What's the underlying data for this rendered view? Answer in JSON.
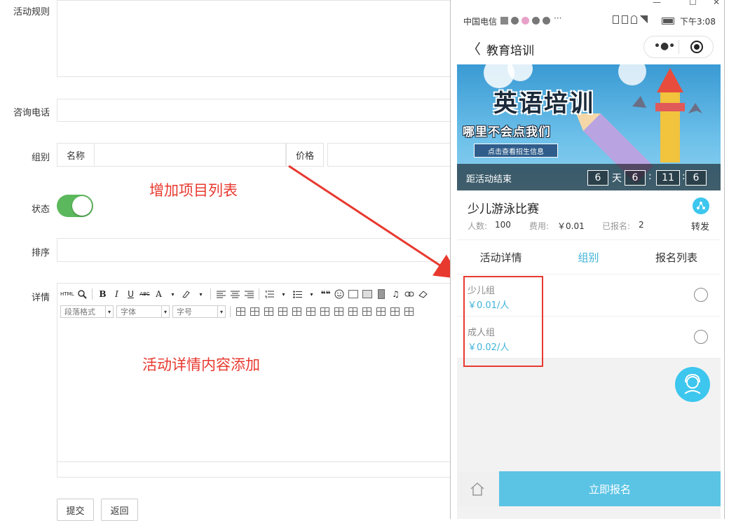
{
  "form": {
    "rules_label": "活动规则",
    "phone_label": "咨询电话",
    "group_label": "组别",
    "group_name_header": "名称",
    "group_price_header": "价格",
    "status_label": "状态",
    "sort_label": "排序",
    "detail_label": "详情",
    "status_on": true,
    "submit_label": "提交",
    "back_label": "返回"
  },
  "editor": {
    "html_label": "HTML",
    "bold": "B",
    "italic": "I",
    "underline": "U",
    "strike": "ABC",
    "fontcolor": "A",
    "quote": "❝❝",
    "paragraph_select": "段落格式",
    "font_select": "字体",
    "size_select": "字号"
  },
  "annotations": {
    "add_group": "增加项目列表",
    "add_detail": "活动详情内容添加"
  },
  "window": {
    "minimize": "—",
    "maximize": "☐",
    "close": "✕"
  },
  "phone": {
    "status": {
      "carrier": "中国电信",
      "time": "下午3:08"
    },
    "nav": {
      "back": "〈",
      "title": "教育培训"
    },
    "banner": {
      "title": "英语培训",
      "subtitle": "哪里不会点我们",
      "tag": "点击查看招生信息",
      "countdown_label": "距活动结束",
      "days": "6",
      "day_unit": "天",
      "hours": "6",
      "minutes": "11",
      "seconds": "6",
      "sep": ":"
    },
    "event": {
      "title": "少儿游泳比赛",
      "people_label": "人数:",
      "people_value": "100",
      "fee_label": "费用:",
      "fee_value": "￥0.01",
      "enrolled_label": "已报名:",
      "enrolled_value": "2",
      "share_label": "转发"
    },
    "tabs": [
      {
        "label": "活动详情",
        "active": false
      },
      {
        "label": "组别",
        "active": true
      },
      {
        "label": "报名列表",
        "active": false
      }
    ],
    "groups": [
      {
        "name": "少儿组",
        "price": "￥0.01/人"
      },
      {
        "name": "成人组",
        "price": "￥0.02/人"
      }
    ],
    "signup_label": "立即报名"
  },
  "colors": {
    "accent": "#5bc4e5",
    "annotation": "#e8392f",
    "toggle": "#5cb85c"
  }
}
